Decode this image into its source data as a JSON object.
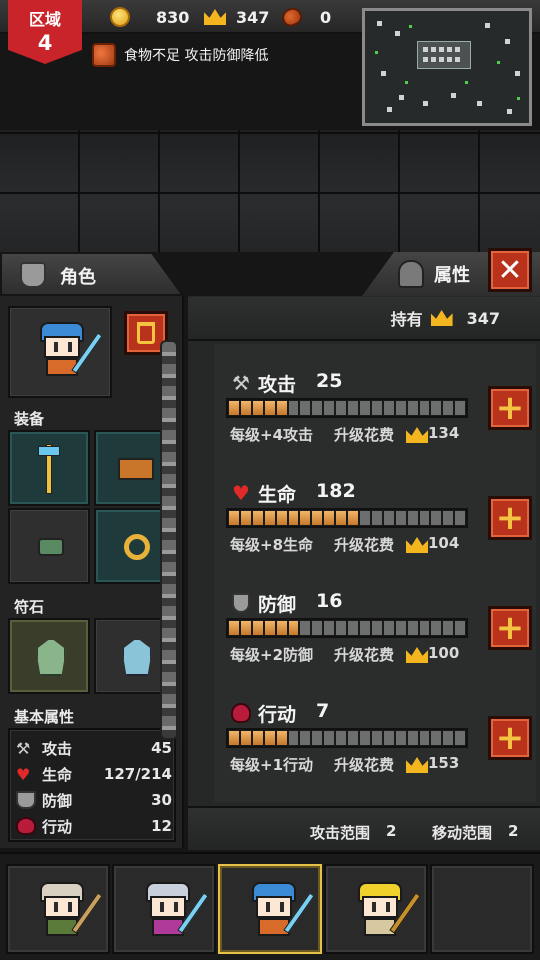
{
  "hud": {
    "region_label": "区域",
    "region_number": "4",
    "coins": "830",
    "crowns": "347",
    "food": "0",
    "alert": "食物不足 攻击防御降低"
  },
  "character_panel": {
    "title": "角色",
    "equipment_label": "装备",
    "runes_label": "符石",
    "base_stats_label": "基本属性",
    "stats": [
      {
        "icon": "axe-icon",
        "label": "攻击",
        "value": "45"
      },
      {
        "icon": "heart-icon",
        "label": "生命",
        "value": "127/214"
      },
      {
        "icon": "shield-icon",
        "label": "防御",
        "value": "30"
      },
      {
        "icon": "action-icon",
        "label": "行动",
        "value": "12"
      }
    ]
  },
  "attribute_panel": {
    "title": "属性",
    "holding_label": "持有",
    "holding_value": "347",
    "attributes": [
      {
        "icon": "axe-icon",
        "name": "攻击",
        "value": "25",
        "per_level": "每级+4攻击",
        "cost_label": "升级花费",
        "cost": "134",
        "filled": 5,
        "segments": 20
      },
      {
        "icon": "heart-icon",
        "name": "生命",
        "value": "182",
        "per_level": "每级+8生命",
        "cost_label": "升级花费",
        "cost": "104",
        "filled": 11,
        "segments": 20
      },
      {
        "icon": "shield-icon",
        "name": "防御",
        "value": "16",
        "per_level": "每级+2防御",
        "cost_label": "升级花费",
        "cost": "100",
        "filled": 6,
        "segments": 20
      },
      {
        "icon": "action-icon",
        "name": "行动",
        "value": "7",
        "per_level": "每级+1行动",
        "cost_label": "升级花费",
        "cost": "153",
        "filled": 5,
        "segments": 20
      }
    ],
    "attack_range_label": "攻击范围",
    "attack_range": "2",
    "move_range_label": "移动范围",
    "move_range": "2"
  },
  "colors": {
    "accent_red": "#b8321c",
    "gold": "#f3b61f",
    "bar_fill": "#e0a05a"
  }
}
